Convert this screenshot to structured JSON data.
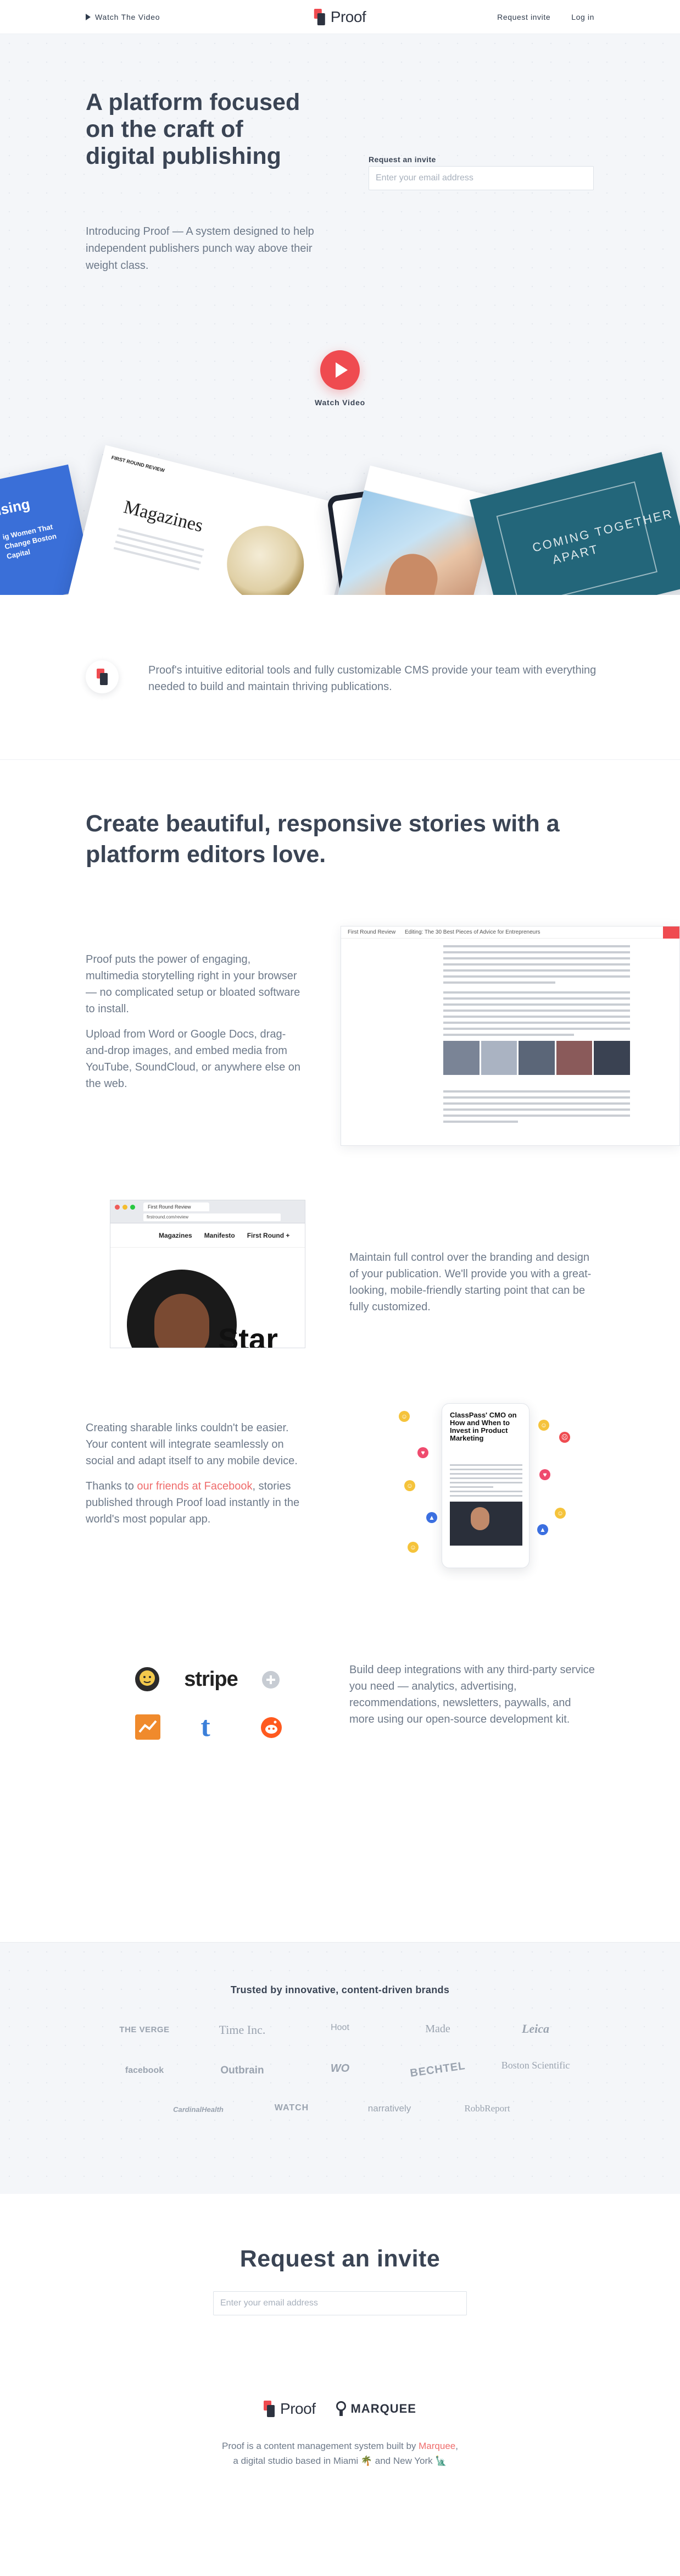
{
  "header": {
    "watch_label": "Watch The Video",
    "logo_text": "Proof",
    "nav": {
      "request_invite": "Request invite",
      "log_in": "Log in"
    }
  },
  "hero": {
    "title": "A platform focused on the craft of digital publishing",
    "lede": "Introducing Proof — A system designed to help independent publishers punch way above their weight class.",
    "invite_label": "Request an invite",
    "email_placeholder": "Enter your email address",
    "video_label": "Watch Video",
    "showcase": {
      "card_blue_big": "ising",
      "card_blue_small": "ig Women That Change Boston Capital",
      "card_mag_header": "FIRST ROUND REVIEW",
      "card_mag_title": "Magazines",
      "card_teal_line1": "COMING TOGETHER",
      "card_teal_line2": "APART"
    }
  },
  "intro": {
    "text": "Proof's intuitive editorial tools and fully customizable CMS provide your team with everything needed to build and maintain thriving publications."
  },
  "features": {
    "heading": "Create beautiful, responsive stories with a platform editors love.",
    "storytelling": {
      "p1": "Proof puts the power of engaging, multimedia storytelling right in your browser — no complicated setup or bloated software to install.",
      "p2": "Upload from Word or Google Docs, drag-and-drop images, and embed media from YouTube, SoundCloud, or anywhere else on the web."
    },
    "editor_shot": {
      "site": "First Round Review",
      "editing_label": "Editing: The 30 Best Pieces of Advice for Entrepreneurs"
    },
    "branding": {
      "text": "Maintain full control over the branding and design of your publication. We'll provide you with a great-looking, mobile-friendly starting point that can be fully customized."
    },
    "browser_shot": {
      "tab": "First Round Review",
      "url": "firstround.com/review",
      "nav": [
        "Magazines",
        "Manifesto",
        "First Round +"
      ],
      "big_word": "Star"
    },
    "mobile": {
      "p1": "Creating sharable links couldn't be easier. Your content will integrate seamlessly on social and adapt itself to any mobile device.",
      "p2_before": "Thanks to ",
      "p2_link": "our friends at Facebook",
      "p2_after": ", stories published through Proof load instantly in the world's most popular app.",
      "phone_headline": "ClassPass' CMO on How and When to Invest in Product Marketing"
    },
    "integrations": {
      "text": "Build deep integrations with any third-party service you need — analytics, advertising, recommendations, newsletters, paywalls, and more using our open-source development kit.",
      "logos": [
        "mailchimp-icon",
        "stripe",
        "plus-icon",
        "chartbeat-icon",
        "tumblr-icon",
        "reddit-icon"
      ],
      "stripe_word": "stripe",
      "tumblr_letter": "t"
    }
  },
  "trusted": {
    "heading": "Trusted by innovative, content-driven brands",
    "brands": [
      "THE VERGE",
      "Time Inc.",
      "Hoot",
      "Made",
      "Leica",
      "facebook",
      "Outbrain",
      "WO",
      "BECHTEL",
      "Boston Scientific",
      "CardinalHealth",
      "WATCH",
      "narratively",
      "RobbReport"
    ]
  },
  "cta": {
    "heading": "Request an invite",
    "email_placeholder": "Enter your email address"
  },
  "footer": {
    "proof_text": "Proof",
    "marquee_text": "MARQUEE",
    "line1_before": "Proof is a content management system built by ",
    "line1_link": "Marquee",
    "line1_after": ",",
    "line2": "a digital studio based in Miami 🌴 and New York 🗽"
  },
  "colors": {
    "accent": "#ef4b50",
    "text_dark": "#3a4454",
    "text_muted": "#6d7989",
    "hero_bg": "#f4f6f9"
  }
}
